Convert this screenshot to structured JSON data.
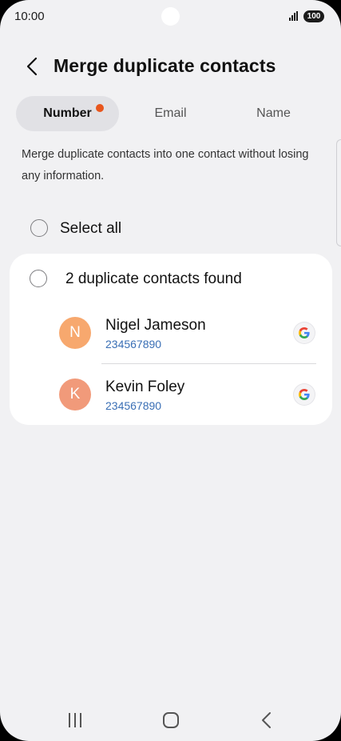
{
  "status_bar": {
    "time": "10:00",
    "battery": "100",
    "signal_icon": "signal-icon"
  },
  "header": {
    "title": "Merge duplicate contacts",
    "back_icon": "chevron-left-icon"
  },
  "tabs": [
    {
      "label": "Number",
      "selected": true,
      "has_badge": true
    },
    {
      "label": "Email",
      "selected": false
    },
    {
      "label": "Name",
      "selected": false
    }
  ],
  "description": "Merge duplicate contacts into one contact without losing any information.",
  "select_all": {
    "label": "Select all",
    "checked": false
  },
  "group": {
    "title": "2 duplicate contacts found",
    "checked": false,
    "contacts": [
      {
        "initial": "N",
        "name": "Nigel Jameson",
        "number": "234567890",
        "account_icon": "google-icon",
        "avatar_color": "#f7a86e"
      },
      {
        "initial": "K",
        "name": "Kevin Foley",
        "number": "234567890",
        "account_icon": "google-icon",
        "avatar_color": "#f19a7a"
      }
    ]
  },
  "colors": {
    "accent_dot": "#e8561d",
    "number_text": "#3a6fb5",
    "background": "#f1f1f3"
  },
  "nav_bar": {
    "recents_icon": "recents-icon",
    "home_icon": "home-icon",
    "back_icon": "back-icon"
  }
}
